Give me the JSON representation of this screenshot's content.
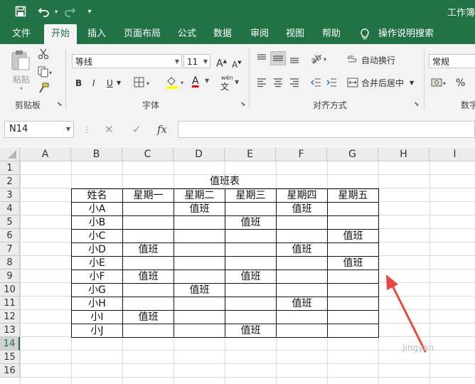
{
  "titlebar": {
    "title": "工作簿",
    "qat_icons": [
      "save-icon",
      "undo-icon",
      "redo-icon",
      "customize-qat-icon"
    ]
  },
  "tabs": [
    {
      "label": "文件",
      "active": false
    },
    {
      "label": "开始",
      "active": true
    },
    {
      "label": "插入",
      "active": false
    },
    {
      "label": "页面布局",
      "active": false
    },
    {
      "label": "公式",
      "active": false
    },
    {
      "label": "数据",
      "active": false
    },
    {
      "label": "审阅",
      "active": false
    },
    {
      "label": "视图",
      "active": false
    },
    {
      "label": "帮助",
      "active": false
    }
  ],
  "tell_me": {
    "label": "操作说明搜索",
    "icon": "lightbulb-icon"
  },
  "ribbon": {
    "clipboard": {
      "paste_label": "粘贴",
      "group_label": "剪贴板"
    },
    "font": {
      "font_name": "等线",
      "font_size": "11",
      "grow_label": "A",
      "shrink_label": "A",
      "bold": "B",
      "italic": "I",
      "underline": "U",
      "font_color_label": "A",
      "phonetic_label": "wén",
      "group_label": "字体"
    },
    "alignment": {
      "wrap_label": "自动换行",
      "merge_label": "合并后居中",
      "group_label": "对齐方式"
    },
    "number": {
      "format": "常规",
      "percent": "%",
      "group_label": "数字"
    },
    "colors": {
      "highlight": "#ffff00",
      "font_color": "#ff0000"
    }
  },
  "formula_bar": {
    "name_box": "N14",
    "cancel": "✕",
    "enter": "✓",
    "fx": "fx",
    "content": ""
  },
  "sheet": {
    "columns": [
      "A",
      "B",
      "C",
      "D",
      "E",
      "F",
      "G",
      "H",
      "I"
    ],
    "rows": [
      "1",
      "2",
      "3",
      "4",
      "5",
      "6",
      "7",
      "8",
      "9",
      "10",
      "11",
      "12",
      "13",
      "14",
      "15",
      "16"
    ],
    "selected_row": "14",
    "table_title": "值班表",
    "header": [
      "姓名",
      "星期一",
      "星期二",
      "星期三",
      "星期四",
      "星期五"
    ],
    "body": [
      [
        "小A",
        "",
        "值班",
        "",
        "值班",
        ""
      ],
      [
        "小B",
        "",
        "",
        "值班",
        "",
        ""
      ],
      [
        "小C",
        "",
        "",
        "",
        "",
        "值班"
      ],
      [
        "小D",
        "值班",
        "",
        "",
        "值班",
        ""
      ],
      [
        "小E",
        "",
        "",
        "",
        "",
        "值班"
      ],
      [
        "小F",
        "值班",
        "",
        "值班",
        "",
        ""
      ],
      [
        "小G",
        "",
        "值班",
        "",
        "",
        ""
      ],
      [
        "小H",
        "",
        "",
        "",
        "值班",
        ""
      ],
      [
        "小I",
        "值班",
        "",
        "",
        "",
        ""
      ],
      [
        "小J",
        "",
        "",
        "值班",
        "",
        ""
      ]
    ]
  },
  "annotation": {
    "arrow_color": "#e8483c"
  },
  "watermark": "Jingyan"
}
